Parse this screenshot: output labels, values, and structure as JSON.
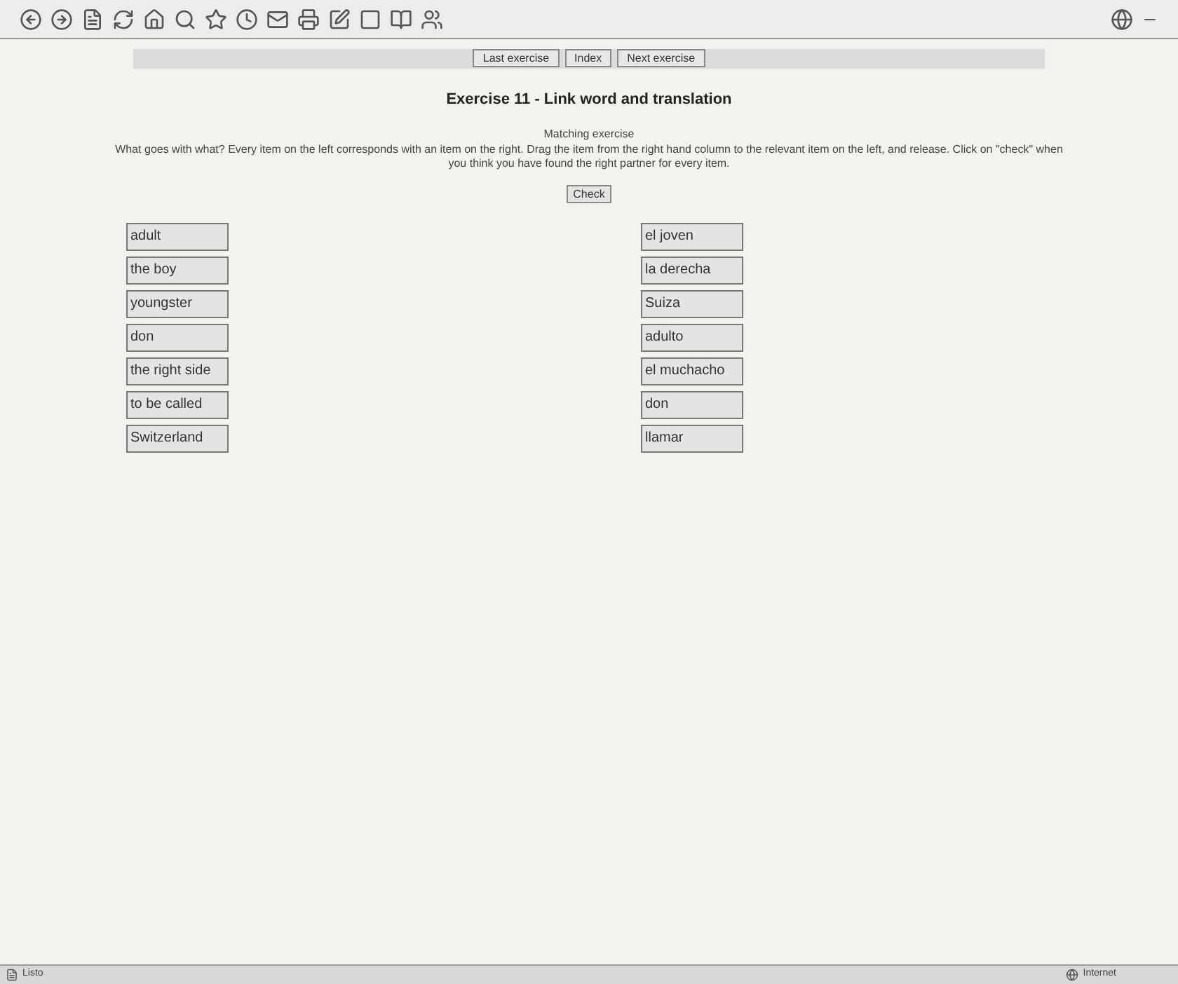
{
  "nav_buttons": [
    "Last exercise",
    "Index",
    "Next exercise"
  ],
  "title": "Exercise 11 - Link word and translation",
  "subtitle": "Matching exercise",
  "instructions": "What goes with what? Every item on the left corresponds with an item on the right. Drag the item from the right hand column to the relevant item on the left, and release. Click on \"check\" when you think you have found the right partner for every item.",
  "check_button": "Check",
  "left_items": [
    "adult",
    "the boy",
    "youngster",
    "don",
    "the right side",
    "to be called",
    "Switzerland"
  ],
  "right_items": [
    "el joven",
    "la derecha",
    "Suiza",
    "adulto",
    "el muchacho",
    "don",
    "llamar"
  ],
  "status_bar": {
    "left": "Listo",
    "right": "Internet"
  }
}
